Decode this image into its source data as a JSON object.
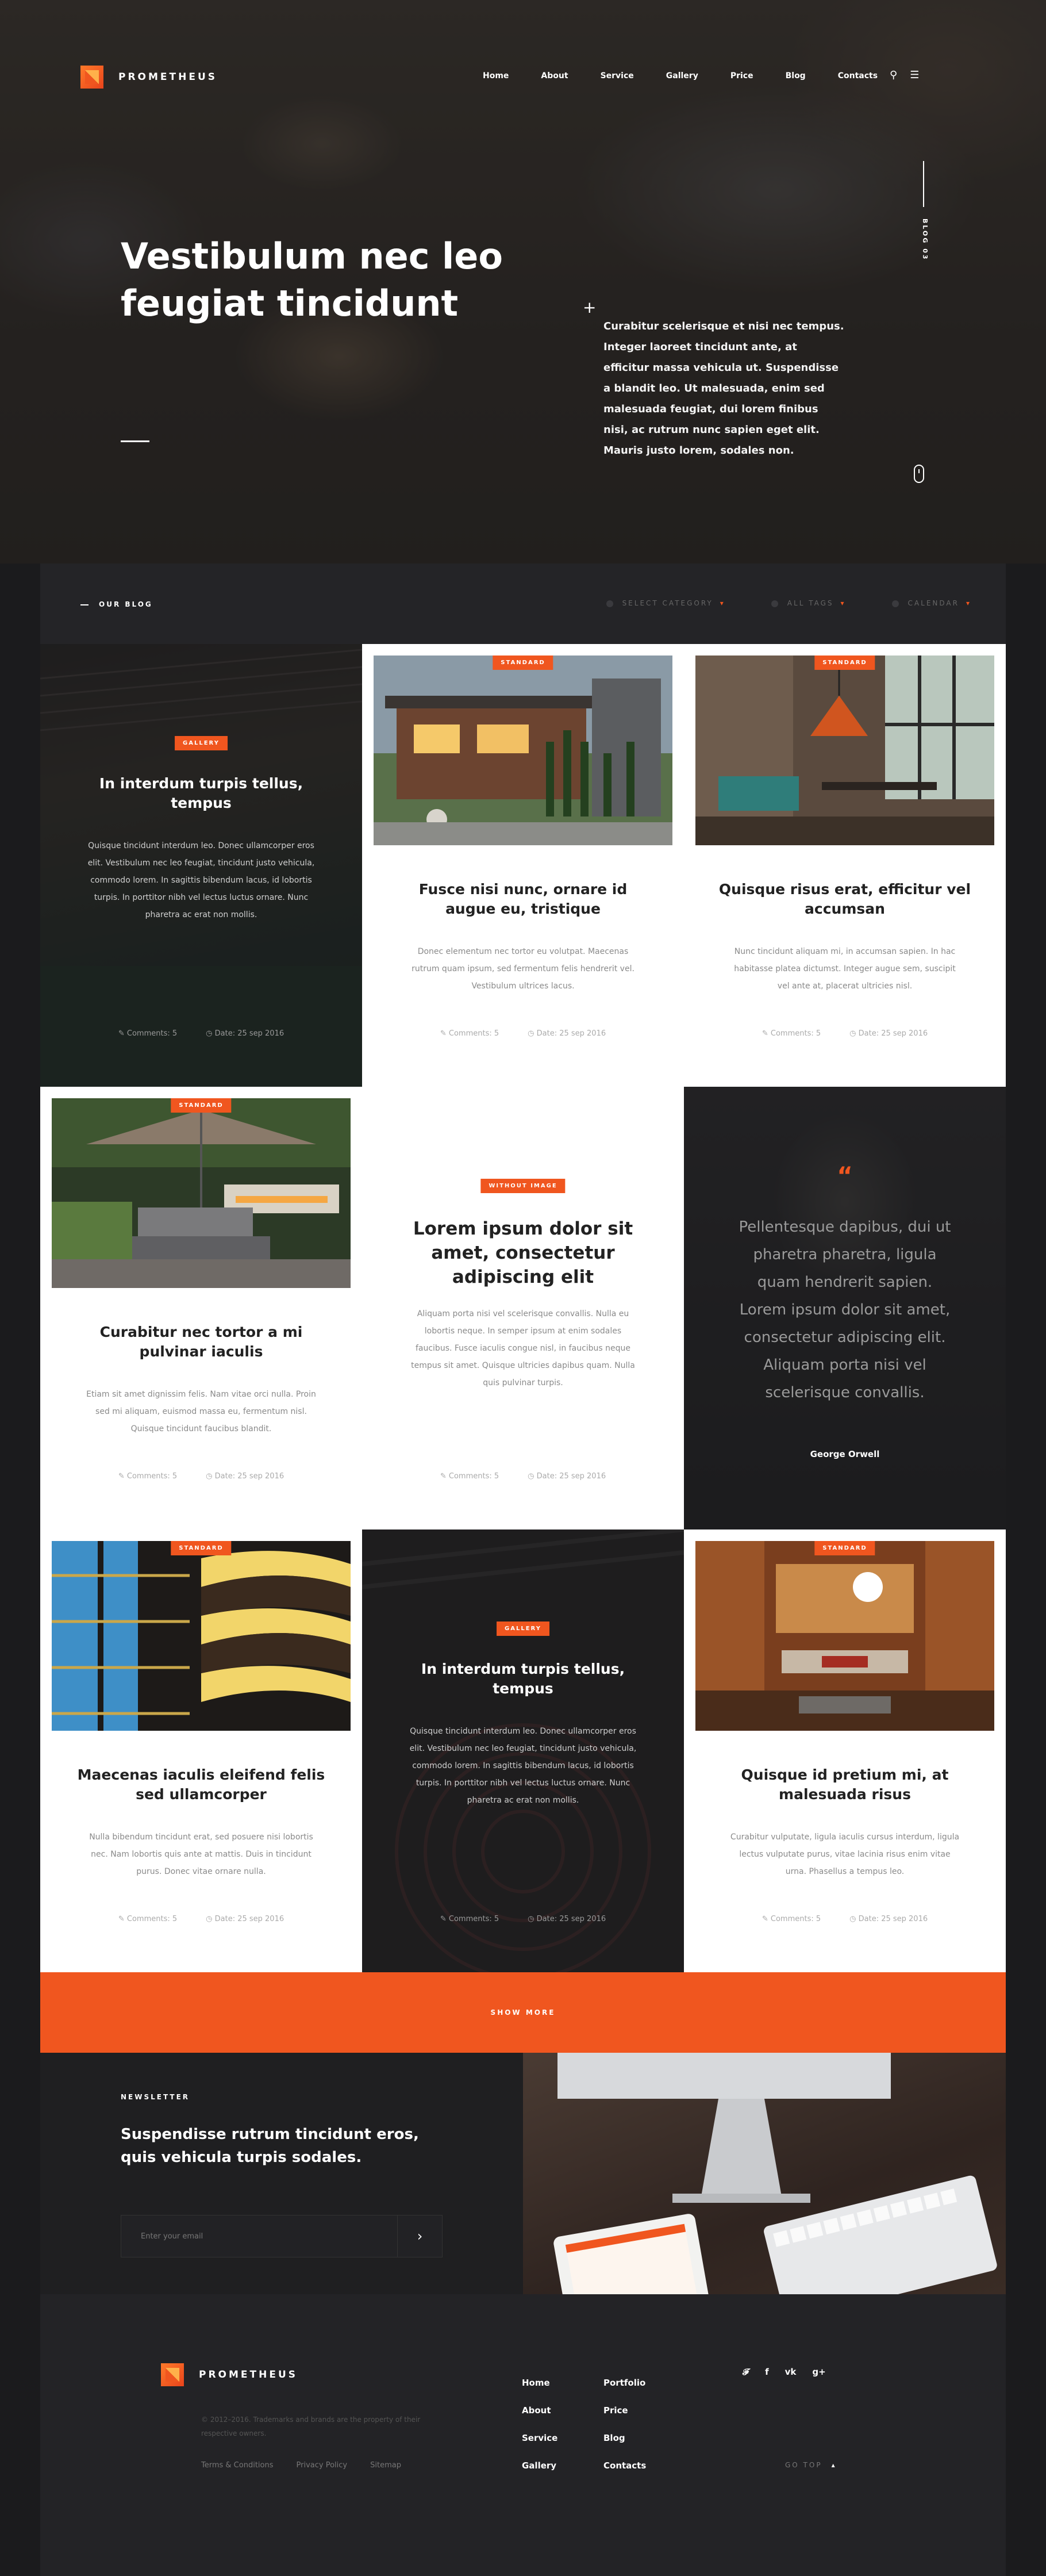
{
  "brand": {
    "name": "PROMETHEUS"
  },
  "nav": [
    "Home",
    "About",
    "Service",
    "Gallery",
    "Price",
    "Blog",
    "Contacts"
  ],
  "hero": {
    "title": "Vestibulum nec leo feugiat tincidunt",
    "text": "Curabitur scelerisque et nisi nec tempus. Integer laoreet tincidunt ante, at efficitur massa vehicula ut. Suspendisse a blandit leo. Ut malesuada, enim sed malesuada feugiat, dui lorem finibus nisi, ac rutrum nunc sapien eget elit. Mauris justo lorem, sodales non.",
    "vertical_label": "BLOG 03"
  },
  "blog": {
    "label": "OUR BLOG",
    "filters": [
      "SELECT CATEGORY",
      "ALL TAGS",
      "CALENDAR"
    ]
  },
  "cards": [
    {
      "tag": "GALLERY",
      "title": "In interdum turpis tellus, tempus",
      "text": "Quisque tincidunt interdum leo. Donec ullamcorper eros elit. Vestibulum nec leo feugiat, tincidunt justo vehicula, commodo lorem. In sagittis bibendum lacus, id lobortis turpis. In porttitor nibh vel lectus luctus ornare. Nunc pharetra ac erat non mollis.",
      "comments": "Comments: 5",
      "date": "Date: 25 sep 2016"
    },
    {
      "tag": "STANDARD",
      "title": "Fusce nisi nunc, ornare id augue eu, tristique",
      "text": "Donec elementum nec tortor eu volutpat. Maecenas rutrum quam ipsum, sed fermentum felis hendrerit vel.  Vestibulum ultrices lacus.",
      "comments": "Comments: 5",
      "date": "Date: 25 sep 2016"
    },
    {
      "tag": "STANDARD",
      "title": "Quisque risus erat, efficitur vel accumsan",
      "text": "Nunc tincidunt aliquam mi, in accumsan sapien. In hac habitasse platea dictumst. Integer augue sem, suscipit vel ante at, placerat ultricies nisl.",
      "comments": "Comments: 5",
      "date": "Date: 25 sep 2016"
    },
    {
      "tag": "STANDARD",
      "title": "Curabitur nec tortor a mi pulvinar iaculis",
      "text": "Etiam sit amet dignissim felis. Nam vitae orci nulla. Proin sed mi aliquam, euismod massa eu, fermentum nisl. Quisque tincidunt faucibus blandit.",
      "comments": "Comments: 5",
      "date": "Date: 25 sep 2016"
    },
    {
      "tag": "WITHOUT IMAGE",
      "title": "Lorem ipsum dolor sit amet, consectetur adipiscing elit",
      "text": "Aliquam porta nisi vel scelerisque convallis. Nulla eu lobortis neque. In semper ipsum at enim sodales faucibus. Fusce iaculis congue nisl, in faucibus neque tempus sit amet. Quisque ultricies dapibus quam. Nulla quis pulvinar turpis.",
      "comments": "Comments: 5",
      "date": "Date: 25 sep 2016"
    },
    {
      "quote": "Pellentesque dapibus, dui ut pharetra pharetra, ligula quam hendrerit sapien. Lorem ipsum dolor sit amet, consectetur adipiscing elit. Aliquam porta nisi vel scelerisque convallis.",
      "author": "George Orwell"
    },
    {
      "tag": "STANDARD",
      "title": "Maecenas iaculis eleifend felis sed ullamcorper",
      "text": "Nulla bibendum tincidunt erat, sed posuere nisi lobortis nec. Nam lobortis quis ante at mattis. Duis in tincidunt purus. Donec vitae ornare nulla.",
      "comments": "Comments: 5",
      "date": "Date: 25 sep 2016"
    },
    {
      "tag": "GALLERY",
      "title": "In interdum turpis tellus, tempus",
      "text": "Quisque tincidunt interdum leo. Donec ullamcorper eros elit. Vestibulum nec leo feugiat, tincidunt justo vehicula, commodo lorem. In sagittis bibendum lacus, id lobortis turpis. In porttitor nibh vel lectus luctus ornare. Nunc pharetra ac erat non mollis.",
      "comments": "Comments: 5",
      "date": "Date: 25 sep 2016"
    },
    {
      "tag": "STANDARD",
      "title": "Quisque id pretium mi, at malesuada risus",
      "text": "Curabitur vulputate, ligula iaculis cursus interdum, ligula lectus vulputate purus, vitae lacinia risus enim vitae urna. Phasellus a tempus leo.",
      "comments": "Comments: 5",
      "date": "Date: 25 sep 2016"
    }
  ],
  "show_more": "SHOW MORE",
  "newsletter": {
    "label": "NEWSLETTER",
    "title": "Suspendisse rutrum tincidunt eros, quis vehicula turpis sodales.",
    "placeholder": "Enter your email"
  },
  "footer": {
    "copyright": "© 2012–2016. Trademarks and brands are the property of their respective owners.",
    "links": [
      "Terms & Conditions",
      "Privacy Policy",
      "Sitemap"
    ],
    "col1": [
      "Home",
      "About",
      "Service",
      "Gallery"
    ],
    "col2": [
      "Portfolio",
      "Price",
      "Blog",
      "Contacts"
    ],
    "go_top": "GO TOP"
  },
  "colors": {
    "accent": "#f0561f",
    "dark": "#1b1b1d"
  }
}
